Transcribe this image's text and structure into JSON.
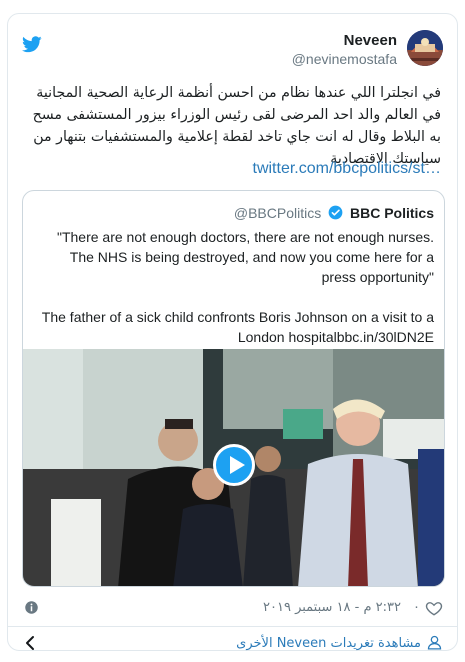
{
  "author": {
    "display_name": "Neveen",
    "handle": "@nevinemostafa"
  },
  "tweet": {
    "text": "في انجلترا اللي عندها نظام من احسن أنظمة الرعاية الصحية المجانية في العالم والد احد المرضى لقى رئيس الوزراء بيزور المستشفى مسح به البلاط وقال له انت جاي تاخد لقطة إعلامية والمستشفيات بتنهار من سياستك الاقتصادية",
    "link_text": "twitter.com/bbcpolitics/st…"
  },
  "quoted_tweet": {
    "name": "BBC Politics",
    "handle": "@BBCPolitics",
    "text": "\"There are not enough doctors, there are not enough nurses. The NHS is being destroyed, and now you come here for a press opportunity\"\n\nThe father of a sick child confronts Boris Johnson on a visit to a London hospitalbbc.in/30lDN2E"
  },
  "footer": {
    "like_count": "٠",
    "timestamp": "٢:٣٢ م - ١٨ سبتمبر ٢٠١٩",
    "more_tweets_link": "مشاهدة تغريدات Neveen الأخرى"
  },
  "colors": {
    "twitter_blue": "#1da1f2",
    "link_blue": "#2b7bb9",
    "muted_gray": "#697882",
    "border": "#e1e8ed"
  },
  "icons": [
    "twitter-bird-icon",
    "verified-badge-icon",
    "play-icon",
    "heart-icon",
    "info-icon",
    "person-icon",
    "chevron-left-icon"
  ]
}
